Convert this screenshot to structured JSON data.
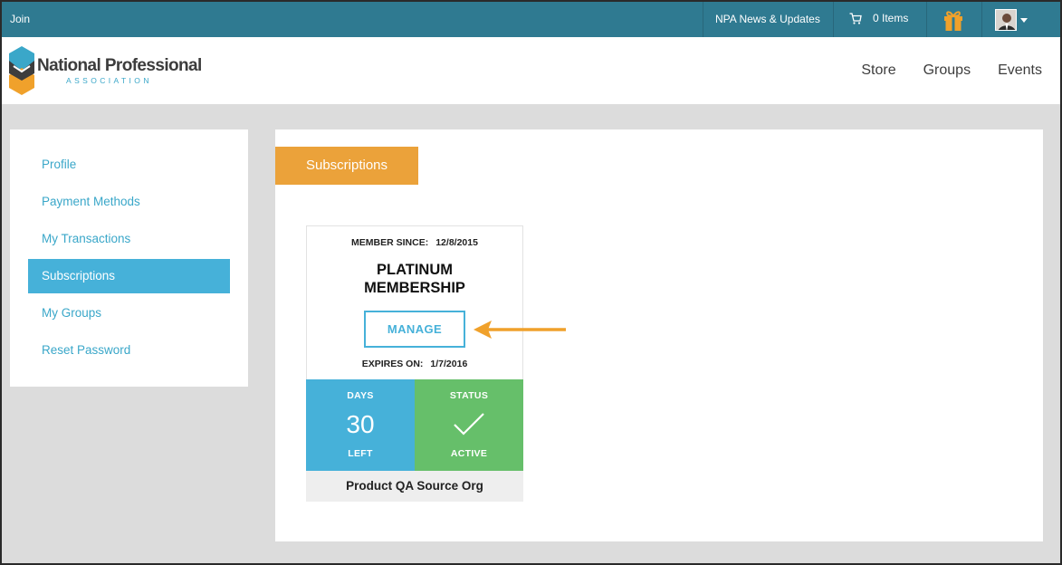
{
  "topbar": {
    "join_label": "Join",
    "news_label": "NPA News & Updates",
    "cart_label": "0 Items",
    "cart_icon": "cart-icon",
    "gift_icon": "gift-icon",
    "avatar_icon": "user-avatar",
    "bg_color": "#2f7a91"
  },
  "header": {
    "brand_main": "National Professional",
    "brand_sub": "ASSOCIATION",
    "nav": [
      {
        "label": "Store"
      },
      {
        "label": "Groups"
      },
      {
        "label": "Events"
      }
    ]
  },
  "sidebar": {
    "items": [
      {
        "label": "Profile",
        "active": false
      },
      {
        "label": "Payment Methods",
        "active": false
      },
      {
        "label": "My Transactions",
        "active": false
      },
      {
        "label": "Subscriptions",
        "active": true
      },
      {
        "label": "My Groups",
        "active": false
      },
      {
        "label": "Reset Password",
        "active": false
      }
    ],
    "accent_color": "#46b1d9"
  },
  "main": {
    "tab_title": "Subscriptions",
    "tab_color": "#eba23a",
    "card": {
      "member_since_label": "MEMBER SINCE:",
      "member_since_value": "12/8/2015",
      "plan_line1": "PLATINUM",
      "plan_line2": "MEMBERSHIP",
      "manage_label": "MANAGE",
      "expires_label": "EXPIRES ON:",
      "expires_value": "1/7/2016",
      "days_top": "DAYS",
      "days_value": "30",
      "days_bottom": "LEFT",
      "status_top": "STATUS",
      "status_bottom": "ACTIVE",
      "status_icon": "check-icon",
      "org_name": "Product QA Source Org",
      "days_color": "#46b1d9",
      "status_color": "#66bf6a"
    },
    "annotation_arrow_color": "#f0a12b"
  }
}
